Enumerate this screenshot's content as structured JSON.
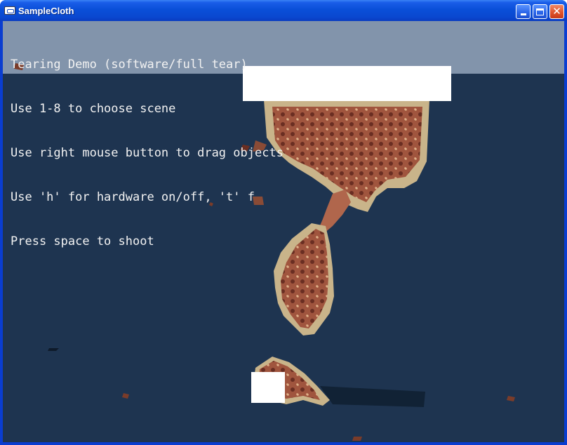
{
  "window": {
    "title": "SampleCloth",
    "icon": "app-window-icon",
    "controls": {
      "minimize_icon": "minimize-icon",
      "maximize_icon": "maximize-icon",
      "close_icon": "close-icon"
    }
  },
  "hud": {
    "lines": [
      "Tearing Demo (software/full tear)",
      "Use 1-8 to choose scene",
      "Use right mouse button to drag objects",
      "Use 'h' for hardware on/off, 't' f",
      "Press space to shoot"
    ]
  },
  "scene": {
    "background_color": "#1e3450",
    "sky_color": "#8294ab",
    "cloth_colors": {
      "border": "#c9b48a",
      "field": "#a0553e",
      "dark": "#6a2e22",
      "light": "#d8b88e"
    }
  }
}
